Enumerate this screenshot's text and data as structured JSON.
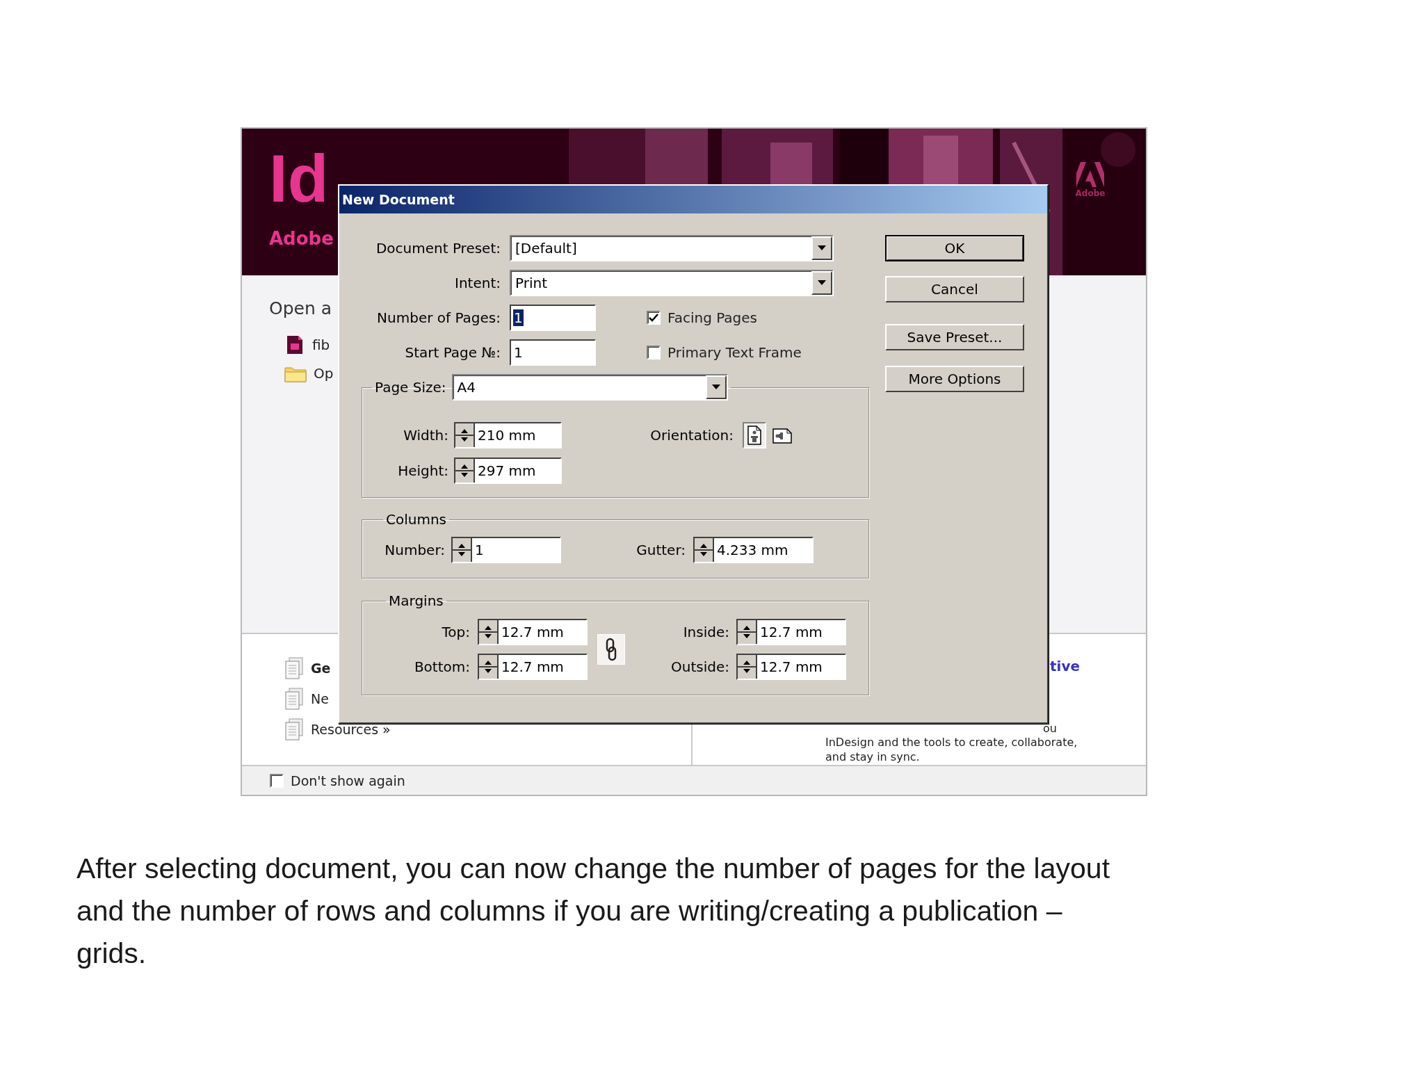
{
  "welcome": {
    "logo": "Id",
    "brand": "Adobe",
    "corner_brand": "Adobe",
    "open_heading": "Open a",
    "recent": [
      {
        "kind": "file",
        "label": "fib"
      },
      {
        "kind": "folder",
        "label": "Op"
      }
    ],
    "links": [
      {
        "label": "Ge",
        "bold": true
      },
      {
        "label": "Ne",
        "bold": false
      },
      {
        "label": "Resources »",
        "bold": false
      }
    ],
    "promo": {
      "heading": "tive",
      "lines": [
        "ou",
        "InDesign and the tools to create, collaborate,",
        "and stay in sync."
      ]
    },
    "dont_show_again": {
      "label": "Don't show again",
      "checked": false
    }
  },
  "dialog": {
    "title": "New Document",
    "fields": [
      {
        "kind": "dropdown",
        "label": "Document Preset:",
        "value": "[Default]"
      },
      {
        "kind": "dropdown",
        "label": "Intent:",
        "value": "Print"
      },
      {
        "kind": "text",
        "label": "Number of Pages:",
        "value": "1",
        "highlighted": true
      },
      {
        "kind": "text",
        "label": "Start Page №:",
        "value": "1",
        "highlighted": false
      }
    ],
    "options": [
      {
        "label": "Facing Pages",
        "checked": true
      },
      {
        "label": "Primary Text Frame",
        "checked": false
      }
    ],
    "page_size": {
      "label": "Page Size:",
      "value": "A4",
      "width": {
        "label": "Width:",
        "value": "210 mm"
      },
      "height": {
        "label": "Height:",
        "value": "297 mm"
      },
      "orientation": {
        "label": "Orientation:",
        "choices": [
          {
            "kind": "portrait",
            "selected": true
          },
          {
            "kind": "landscape",
            "selected": false
          }
        ]
      }
    },
    "columns": {
      "title": "Columns",
      "number": {
        "label": "Number:",
        "value": "1"
      },
      "gutter": {
        "label": "Gutter:",
        "value": "4.233 mm"
      }
    },
    "margins": {
      "title": "Margins",
      "top": {
        "label": "Top:",
        "value": "12.7 mm"
      },
      "bottom": {
        "label": "Bottom:",
        "value": "12.7 mm"
      },
      "inside": {
        "label": "Inside:",
        "value": "12.7 mm"
      },
      "outside": {
        "label": "Outside:",
        "value": "12.7 mm"
      }
    },
    "buttons": [
      {
        "label": "OK",
        "default": true
      },
      {
        "label": "Cancel",
        "default": false
      },
      {
        "label": "Save Preset...",
        "default": false
      },
      {
        "label": "More Options",
        "default": false
      }
    ]
  },
  "caption": "After selecting document, you can now change the number of pages for the layout and the number of rows and columns if you are writing/creating a publication – grids."
}
